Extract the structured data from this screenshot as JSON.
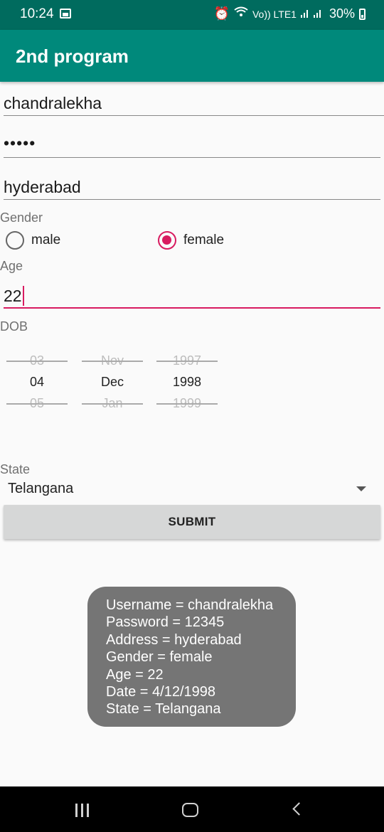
{
  "status_bar": {
    "time": "10:24",
    "network": "Vo)) LTE1",
    "battery": "30%"
  },
  "app_bar": {
    "title": "2nd program"
  },
  "form": {
    "username_value": "chandralekha",
    "password_value": "•••••",
    "address_value": "hyderabad",
    "gender_label": "Gender",
    "gender_options": [
      "male",
      "female"
    ],
    "gender_selected": "female",
    "age_label": "Age",
    "age_value": "22",
    "dob_label": "DOB",
    "dob_picker": {
      "day": {
        "prev": "03",
        "selected": "04",
        "next": "05"
      },
      "month": {
        "prev": "Nov",
        "selected": "Dec",
        "next": "Jan"
      },
      "year": {
        "prev": "1997",
        "selected": "1998",
        "next": "1999"
      }
    },
    "state_label": "State",
    "state_value": "Telangana",
    "submit_label": "SUBMIT"
  },
  "toast": {
    "lines": [
      "Username = chandralekha",
      "Password = 12345",
      "Address = hyderabad",
      "Gender = female",
      "Age = 22",
      "Date = 4/12/1998",
      "State = Telangana"
    ]
  },
  "colors": {
    "status_bar": "#006b5e",
    "app_bar": "#00897b",
    "accent": "#d81b60",
    "toast_bg": "#757575"
  },
  "icons": [
    "image-icon",
    "alarm-icon",
    "wifi-icon",
    "signal-icon",
    "battery-icon",
    "dropdown-arrow-icon",
    "recent-apps-icon",
    "home-icon",
    "back-icon"
  ]
}
